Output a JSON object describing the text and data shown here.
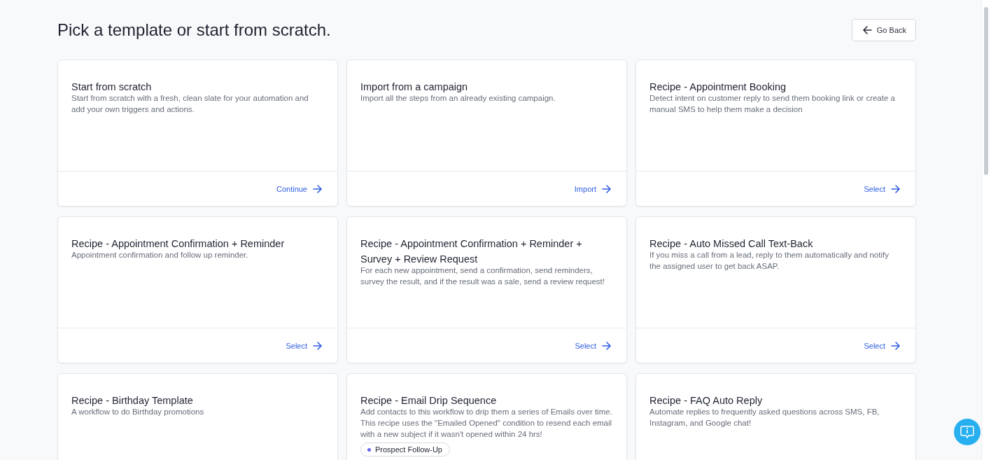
{
  "page_title": "Pick a template or start from scratch.",
  "go_back": {
    "label": "Go Back"
  },
  "templates": [
    {
      "title": "Start from scratch",
      "description": "Start from scratch with a fresh, clean slate for your automation and add your own triggers and actions.",
      "action": "Continue"
    },
    {
      "title": "Import from a campaign",
      "description": "Import all the steps from an already existing campaign.",
      "action": "Import"
    },
    {
      "title": "Recipe - Appointment Booking",
      "description": "Detect intent on customer reply to send them booking link or create a manual SMS to help them make a decision",
      "action": "Select"
    },
    {
      "title": "Recipe - Appointment Confirmation + Reminder",
      "description": "Appointment confirmation and follow up reminder.",
      "action": "Select"
    },
    {
      "title": "Recipe - Appointment Confirmation + Reminder + Survey + Review Request",
      "description": "For each new appointment, send a confirmation, send reminders, survey the result, and if the result was a sale, send a review request!",
      "action": "Select"
    },
    {
      "title": "Recipe - Auto Missed Call Text-Back",
      "description": "If you miss a call from a lead, reply to them automatically and notify the assigned user to get back ASAP.",
      "action": "Select"
    },
    {
      "title": "Recipe - Birthday Template",
      "description": "A workflow to do Birthday promotions"
    },
    {
      "title": "Recipe - Email Drip Sequence",
      "description": "Add contacts to this workflow to drip them a series of Emails over time. This recipe uses the \"Emailed Opened\" condition to resend each email with a new subject if it wasn't opened within 24 hrs!",
      "tags": [
        "Prospect Follow-Up"
      ]
    },
    {
      "title": "Recipe - FAQ Auto Reply",
      "description": "Automate replies to frequently asked questions across SMS, FB, Instagram, and Google chat!"
    }
  ]
}
